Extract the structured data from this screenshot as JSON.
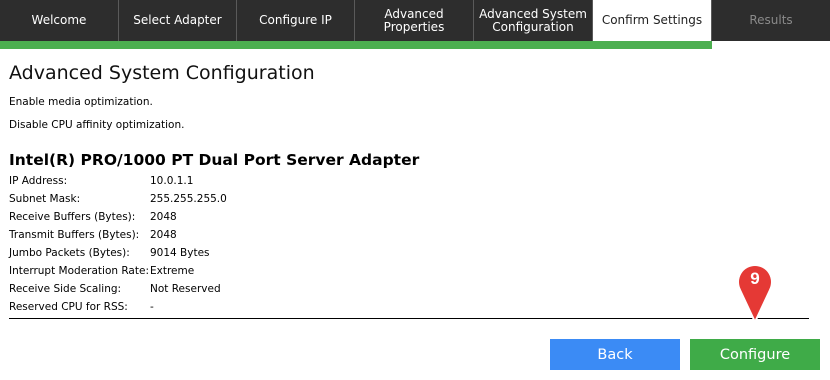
{
  "tabs": [
    {
      "label": "Welcome",
      "state": "normal"
    },
    {
      "label": "Select Adapter",
      "state": "normal"
    },
    {
      "label": "Configure IP",
      "state": "normal"
    },
    {
      "label": "Advanced Properties",
      "state": "normal"
    },
    {
      "label": "Advanced System\nConfiguration",
      "state": "normal"
    },
    {
      "label": "Confirm Settings",
      "state": "active"
    },
    {
      "label": "Results",
      "state": "disabled"
    }
  ],
  "page_title": "Advanced System Configuration",
  "notes": [
    "Enable media optimization.",
    "Disable CPU affinity optimization."
  ],
  "adapter": {
    "name": "Intel(R) PRO/1000 PT Dual Port Server Adapter",
    "properties": [
      {
        "label": "IP Address:",
        "value": "10.0.1.1"
      },
      {
        "label": "Subnet Mask:",
        "value": "255.255.255.0"
      },
      {
        "label": "Receive Buffers (Bytes):",
        "value": "2048"
      },
      {
        "label": "Transmit Buffers (Bytes):",
        "value": "2048"
      },
      {
        "label": "Jumbo Packets (Bytes):",
        "value": "9014 Bytes"
      },
      {
        "label": "Interrupt Moderation Rate:",
        "value": "Extreme"
      },
      {
        "label": "Receive Side Scaling:",
        "value": "Not Reserved"
      },
      {
        "label": "Reserved CPU for RSS:",
        "value": "-"
      }
    ]
  },
  "buttons": {
    "back": "Back",
    "configure": "Configure"
  },
  "step_marker": {
    "number": "9",
    "icon": "map-pin-marker-icon"
  },
  "colors": {
    "tabbar_bg": "#2d2d2d",
    "progress": "#4caf50",
    "back_button": "#3b8bf5",
    "configure_button": "#3fab48",
    "marker": "#e53935"
  }
}
